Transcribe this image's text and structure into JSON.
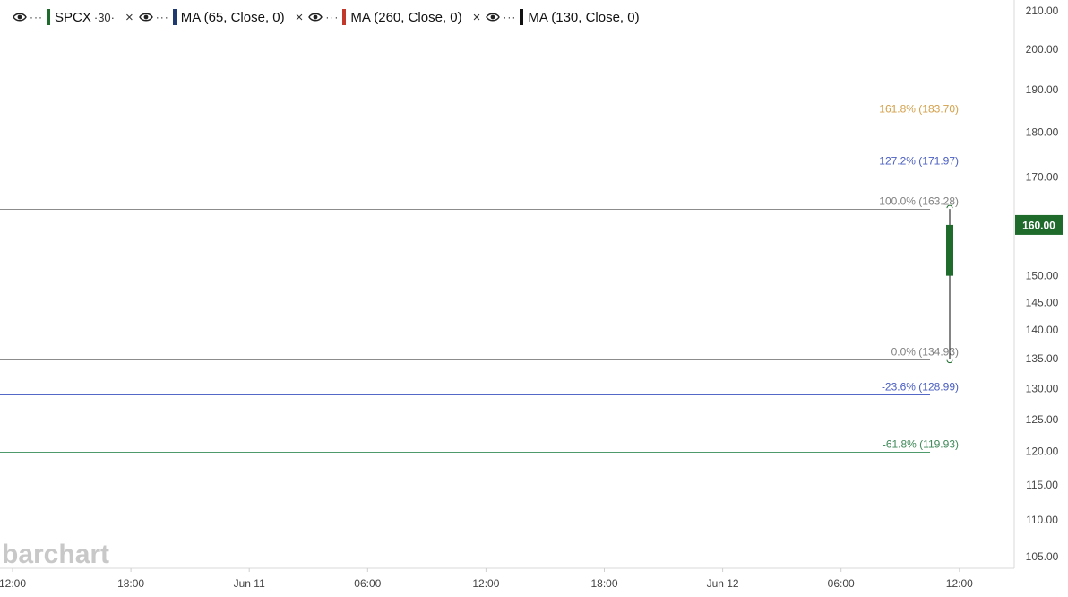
{
  "legend": {
    "symbol": "SPCX",
    "interval": "·30·",
    "indicators": [
      {
        "label": "MA (65, Close, 0)",
        "color": "#1f3a6e"
      },
      {
        "label": "MA (260, Close, 0)",
        "color": "#c0392b"
      },
      {
        "label": "MA (130, Close, 0)",
        "color": "#111111"
      }
    ],
    "symbol_color": "#1e6b2c",
    "close_glyph": "×",
    "menu_glyph": "···"
  },
  "price_badge": {
    "text": "160.00",
    "value": 160.0,
    "color": "#1e6b2c"
  },
  "watermark": "barchart",
  "chart_data": {
    "type": "candlestick",
    "title": "",
    "xlabel": "",
    "ylabel": "",
    "y_axis_ticks": [
      210,
      200,
      190,
      180,
      170,
      160,
      150,
      145,
      140,
      135,
      130,
      125,
      120,
      115,
      110,
      105
    ],
    "y_axis_scale": "log",
    "y_range": [
      103.5,
      211.5
    ],
    "x_axis_ticks": [
      "12:00",
      "18:00",
      "Jun 11",
      "06:00",
      "12:00",
      "18:00",
      "Jun 12",
      "06:00",
      "12:00"
    ],
    "grid": false,
    "candles": [
      {
        "time": "Jun 12 10:30",
        "open": 150.0,
        "high": 163.28,
        "low": 134.93,
        "close": 160.0,
        "color": "#1e6b2c"
      }
    ],
    "fibonacci_levels": [
      {
        "label": "161.8% (183.70)",
        "price": 183.7,
        "color": "#e8b86a",
        "text_color": "#d4a04a"
      },
      {
        "label": "127.2% (171.97)",
        "price": 171.97,
        "color": "#5468c8",
        "text_color": "#4a5ec0"
      },
      {
        "label": "100.0% (163.28)",
        "price": 163.28,
        "color": "#8c8c8c",
        "text_color": "#808080"
      },
      {
        "label": "0.0% (134.93)",
        "price": 134.93,
        "color": "#8c8c8c",
        "text_color": "#808080"
      },
      {
        "label": "-23.6% (128.99)",
        "price": 128.99,
        "color": "#5468c8",
        "text_color": "#4a5ec0"
      },
      {
        "label": "-61.8% (119.93)",
        "price": 119.93,
        "color": "#4f9a6a",
        "text_color": "#3f8a5a"
      }
    ]
  }
}
